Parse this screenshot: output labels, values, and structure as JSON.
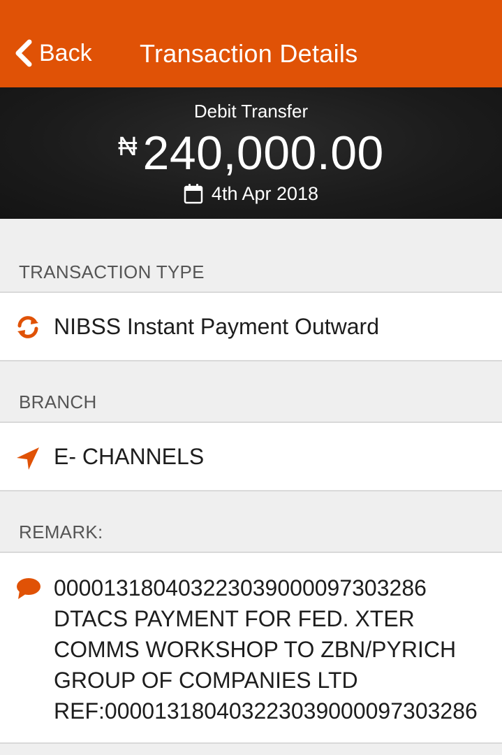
{
  "header": {
    "back_label": "Back",
    "title": "Transaction Details",
    "background_color": "#e05206"
  },
  "summary": {
    "transaction_kind": "Debit Transfer",
    "currency_symbol": "₦",
    "amount": "240,000.00",
    "date": "4th Apr 2018",
    "date_icon": "calendar-icon"
  },
  "transaction_type": {
    "label": "TRANSACTION TYPE",
    "icon": "refresh-icon",
    "value": "NIBSS Instant Payment Outward"
  },
  "branch": {
    "label": "BRANCH",
    "icon": "location-arrow-icon",
    "value": "E- CHANNELS"
  },
  "remark": {
    "label": "REMARK:",
    "icon": "comment-icon",
    "lines": [
      "000013180403223039000097303286",
      "DTACS PAYMENT FOR FED. XTER",
      "COMMS WORKSHOP TO ZBN/PYRICH",
      "GROUP OF COMPANIES LTD",
      "REF:000013180403223039000097303286"
    ]
  },
  "accent_color": "#e05206"
}
